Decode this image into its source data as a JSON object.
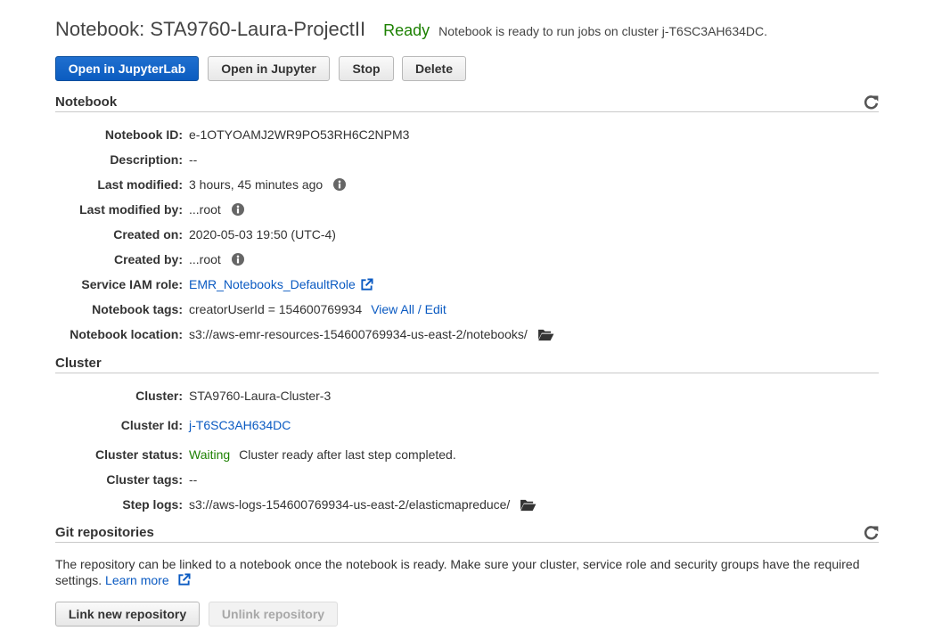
{
  "header": {
    "title": "Notebook: STA9760-Laura-ProjectII",
    "status": "Ready",
    "status_message": "Notebook is ready to run jobs on cluster j-T6SC3AH634DC."
  },
  "toolbar": {
    "open_jupyterlab": "Open in JupyterLab",
    "open_jupyter": "Open in Jupyter",
    "stop": "Stop",
    "delete": "Delete"
  },
  "notebook": {
    "section_title": "Notebook",
    "rows": [
      {
        "label": "Notebook ID:",
        "value": "e-1OTYOAMJ2WR9PO53RH6C2NPM3"
      },
      {
        "label": "Description:",
        "value": "--"
      },
      {
        "label": "Last modified:",
        "value": "3 hours, 45 minutes ago"
      },
      {
        "label": "Last modified by:",
        "value": "...root"
      },
      {
        "label": "Created on:",
        "value": "2020-05-03 19:50 (UTC-4)"
      },
      {
        "label": "Created by:",
        "value": "...root"
      },
      {
        "label": "Service IAM role:",
        "value": "EMR_Notebooks_DefaultRole"
      },
      {
        "label": "Notebook tags:",
        "value": "creatorUserId = 154600769934",
        "link": "View All / Edit"
      },
      {
        "label": "Notebook location:",
        "value": "s3://aws-emr-resources-154600769934-us-east-2/notebooks/"
      }
    ]
  },
  "cluster": {
    "section_title": "Cluster",
    "rows": [
      {
        "label": "Cluster:",
        "value": "STA9760-Laura-Cluster-3"
      },
      {
        "label": "Cluster Id:",
        "value": "j-T6SC3AH634DC"
      },
      {
        "label": "Cluster status:",
        "value": "Waiting",
        "message": "Cluster ready after last step completed."
      },
      {
        "label": "Cluster tags:",
        "value": "--"
      },
      {
        "label": "Step logs:",
        "value": "s3://aws-logs-154600769934-us-east-2/elasticmapreduce/"
      }
    ]
  },
  "git": {
    "section_title": "Git repositories",
    "description": "The repository can be linked to a notebook once the notebook is ready. Make sure your cluster, service role and security groups have the required settings.",
    "learn_more": "Learn more",
    "link_button": "Link new repository",
    "unlink_button": "Unlink repository"
  },
  "colors": {
    "primary": "#0b5cc0",
    "link": "#0a5ac2",
    "success": "#1d8102"
  },
  "icons": [
    "refresh-icon",
    "info-icon",
    "external-link-icon",
    "folder-open-icon"
  ]
}
